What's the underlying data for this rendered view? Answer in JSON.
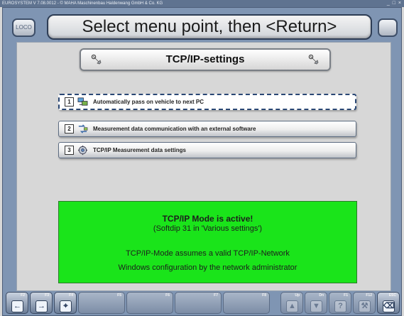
{
  "window": {
    "title": "EUROSYSTEM V 7.08.0012 - © MAHA Maschinenbau Haldenwang GmbH & Co. KG",
    "controls": "_ □ ×"
  },
  "header": {
    "logo_label": "LOCO",
    "title": "Select menu point, then <Return>"
  },
  "section": {
    "title": "TCP/IP-settings"
  },
  "menu": [
    {
      "number": "1",
      "icon": "computer-network-icon",
      "label": "Automatically pass on vehicle to next PC",
      "selected": true
    },
    {
      "number": "2",
      "icon": "data-transfer-icon",
      "label": "Measurement data communication with an external software",
      "selected": false
    },
    {
      "number": "3",
      "icon": "settings-gear-icon",
      "label": "TCP/IP Measurement data settings",
      "selected": false
    }
  ],
  "status": {
    "color": "#1ae41a",
    "line1": "TCP/IP Mode is active!",
    "line2": "(Softdip 31 in 'Various settings')",
    "line3": "TCP/IP-Mode assumes a valid TCP/IP-Network",
    "line4": "Windows configuration by the network administrator"
  },
  "toolbar": {
    "keys": [
      {
        "label": "F2",
        "icon": "arrow-left-icon",
        "enabled": true
      },
      {
        "label": "F3",
        "icon": "arrow-right-icon",
        "enabled": true
      },
      {
        "label": "F4",
        "icon": "network-icon",
        "enabled": true
      },
      {
        "label": "F5",
        "enabled": false
      },
      {
        "label": "F6",
        "enabled": false
      },
      {
        "label": "F7",
        "enabled": false
      },
      {
        "label": "F8",
        "enabled": false
      },
      {
        "label": "Up",
        "icon": "up-icon",
        "enabled": false
      },
      {
        "label": "Dn",
        "icon": "down-icon",
        "enabled": false
      },
      {
        "label": "F1",
        "icon": "help-icon",
        "enabled": false
      },
      {
        "label": "F12",
        "icon": "tool-icon",
        "enabled": false
      },
      {
        "label": "ESC",
        "icon": "exit-door-icon",
        "enabled": true
      }
    ]
  }
}
